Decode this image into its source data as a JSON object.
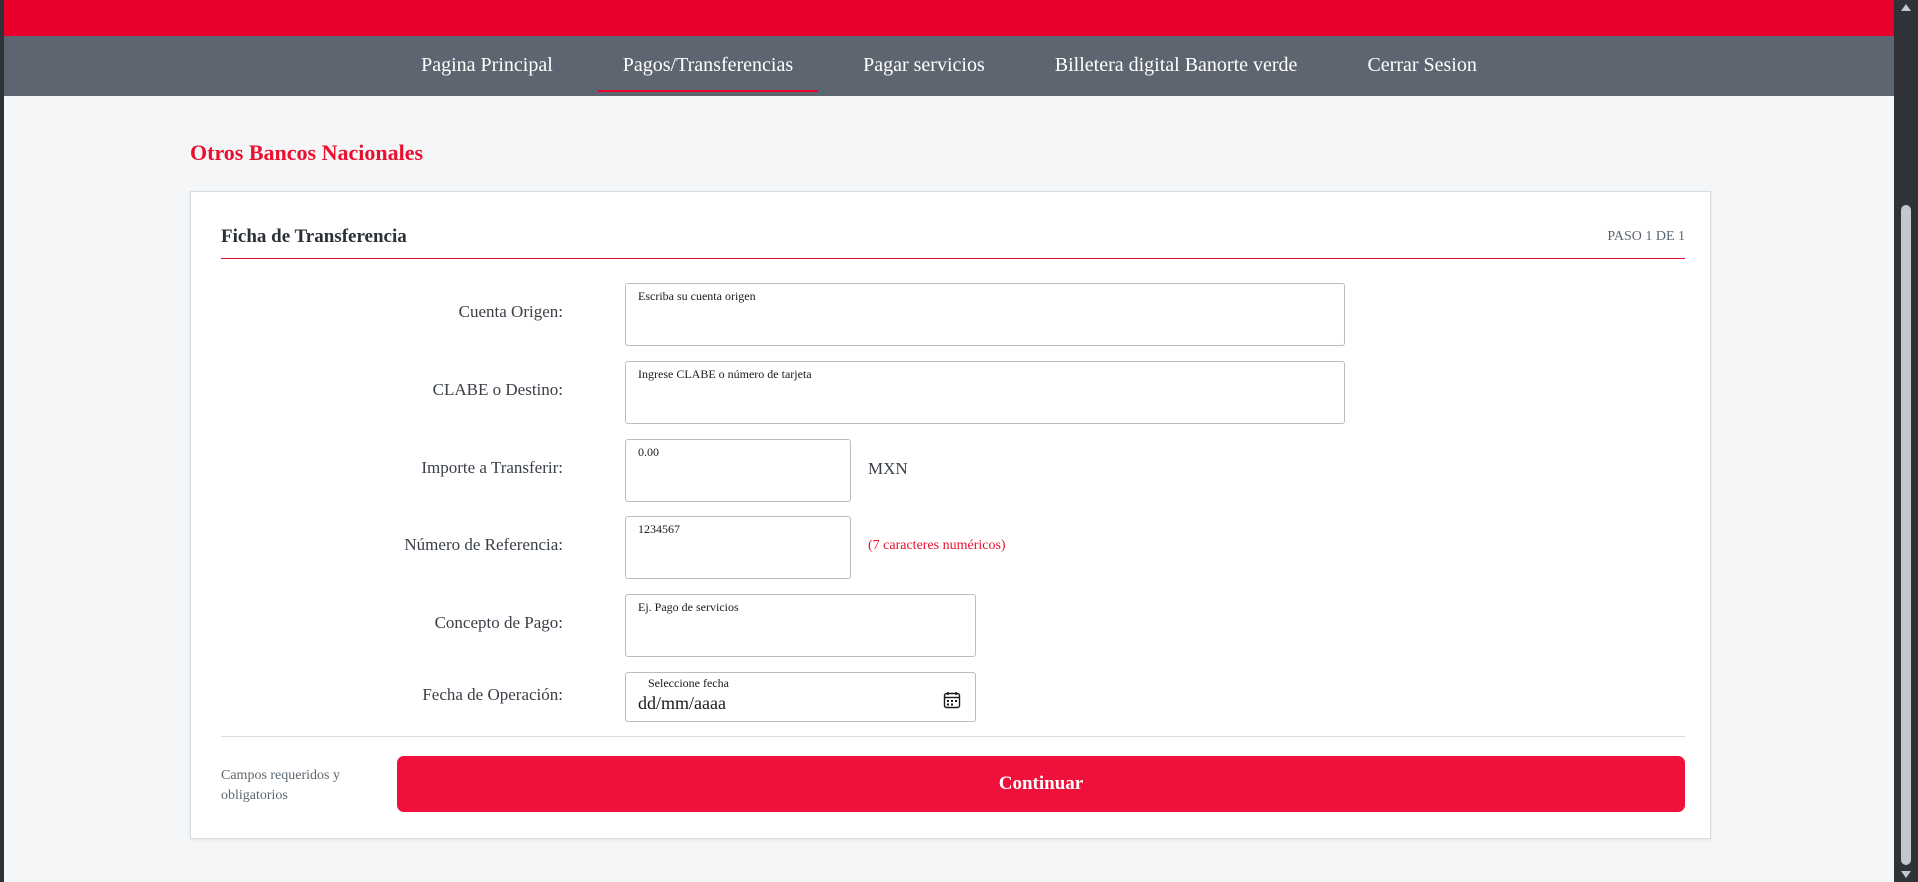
{
  "nav": {
    "items": [
      {
        "label": "Pagina Principal",
        "active": false
      },
      {
        "label": "Pagos/Transferencias",
        "active": true
      },
      {
        "label": "Pagar servicios",
        "active": false
      },
      {
        "label": "Billetera digital Banorte verde",
        "active": false
      },
      {
        "label": "Cerrar Sesion",
        "active": false
      }
    ]
  },
  "page": {
    "title": "Otros Bancos Nacionales"
  },
  "card": {
    "title": "Ficha de Transferencia",
    "step": "PASO 1 DE 1"
  },
  "form": {
    "cuenta_origen": {
      "label": "Cuenta Origen:",
      "placeholder": "Escriba su cuenta origen"
    },
    "clabe_destino": {
      "label": "CLABE o Destino:",
      "placeholder": "Ingrese CLABE o número de tarjeta"
    },
    "importe": {
      "label": "Importe a Transferir:",
      "placeholder": "0.00",
      "currency": "MXN"
    },
    "referencia": {
      "label": "Número de Referencia:",
      "placeholder": "1234567",
      "hint": "(7 caracteres numéricos)"
    },
    "concepto": {
      "label": "Concepto de Pago:",
      "placeholder": "Ej. Pago de servicios"
    },
    "fecha": {
      "label": "Fecha de Operación:",
      "caption": "Seleccione fecha",
      "placeholder": "dd/mm/aaaa",
      "icon": "calendar-icon"
    }
  },
  "footer": {
    "required_note": "Campos requeridos y obligatorios",
    "continue_label": "Continuar"
  },
  "colors": {
    "brand_red": "#e9002c",
    "nav_gray": "#5d6670",
    "button_red": "#f0103c"
  }
}
